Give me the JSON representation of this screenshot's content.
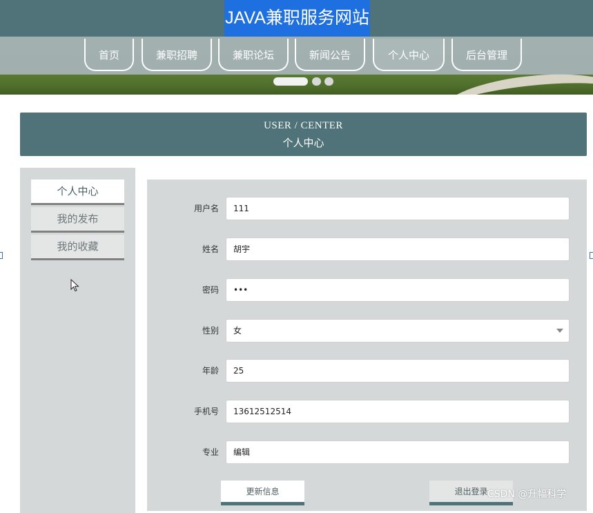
{
  "header": {
    "site_title": "JAVA兼职服务网站"
  },
  "nav": {
    "items": [
      {
        "label": "首页"
      },
      {
        "label": "兼职招聘"
      },
      {
        "label": "兼职论坛"
      },
      {
        "label": "新闻公告"
      },
      {
        "label": "个人中心",
        "active": true
      },
      {
        "label": "后台管理"
      }
    ]
  },
  "carousel": {
    "slide_count": 3,
    "active_index": 0
  },
  "section": {
    "title_en": "USER / CENTER",
    "title_cn": "个人中心"
  },
  "sidebar": {
    "items": [
      {
        "label": "个人中心",
        "active": true
      },
      {
        "label": "我的发布"
      },
      {
        "label": "我的收藏"
      }
    ]
  },
  "form": {
    "fields": [
      {
        "label": "用户名",
        "value": "111"
      },
      {
        "label": "姓名",
        "value": "胡宇"
      },
      {
        "label": "密码",
        "value": "•••"
      },
      {
        "label": "性别",
        "value": "女"
      },
      {
        "label": "年龄",
        "value": "25"
      },
      {
        "label": "手机号",
        "value": "13612512514"
      },
      {
        "label": "专业",
        "value": "编辑"
      }
    ],
    "update_button": "更新信息",
    "logout_button": "退出登录"
  },
  "watermark": "CSDN @升幅科学",
  "colors": {
    "primary": "#4f7379",
    "title_highlight": "#1e6fe0",
    "panel": "#d4d8d9"
  }
}
